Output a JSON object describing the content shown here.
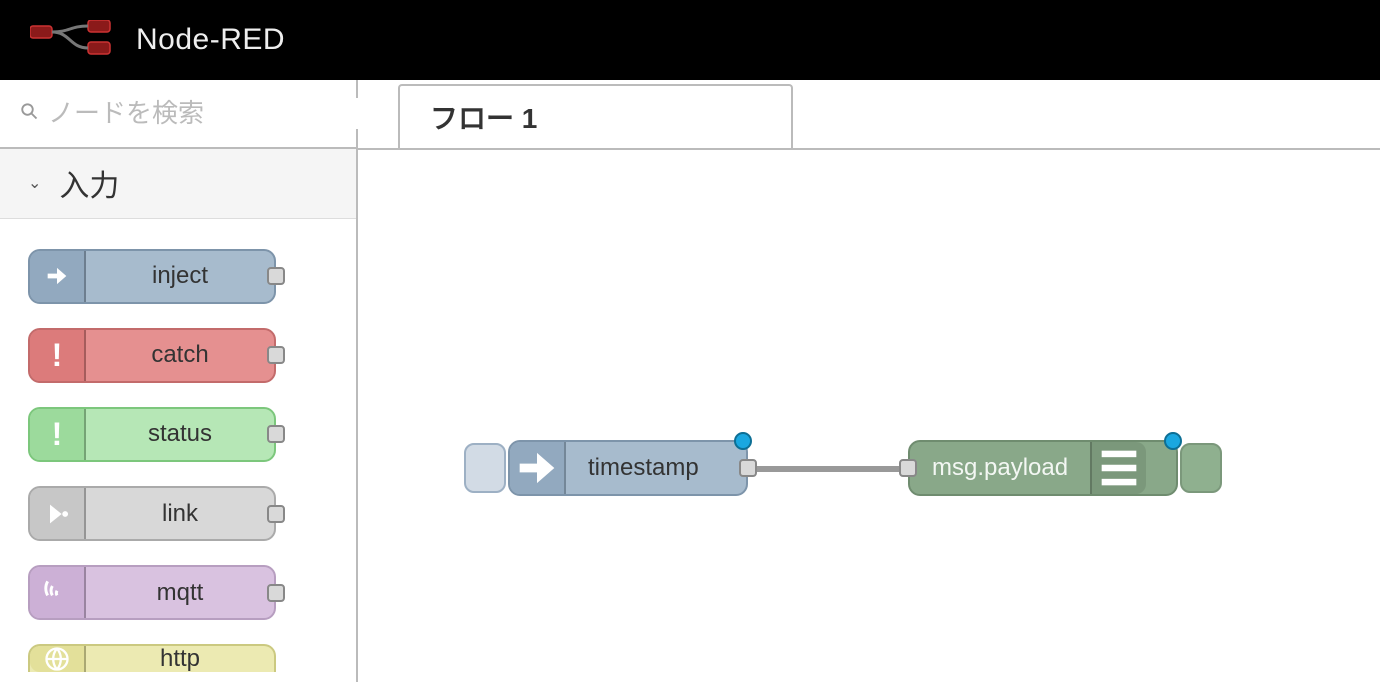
{
  "app": {
    "title": "Node-RED"
  },
  "search": {
    "placeholder": "ノードを検索"
  },
  "palette": {
    "category_label": "入力",
    "nodes": [
      {
        "kind": "inject",
        "label": "inject"
      },
      {
        "kind": "catch",
        "label": "catch"
      },
      {
        "kind": "status",
        "label": "status"
      },
      {
        "kind": "link",
        "label": "link"
      },
      {
        "kind": "mqtt",
        "label": "mqtt"
      },
      {
        "kind": "http",
        "label": "http"
      }
    ]
  },
  "workspace": {
    "tabs": [
      {
        "label": "フロー 1"
      }
    ]
  },
  "flow": {
    "nodes": [
      {
        "id": "inject1",
        "type": "inject",
        "label": "timestamp",
        "changed": true
      },
      {
        "id": "debug1",
        "type": "debug",
        "label": "msg.payload",
        "changed": true
      }
    ],
    "wires": [
      {
        "from": "inject1",
        "to": "debug1"
      }
    ]
  },
  "icons": {
    "inject": "arrow-right-icon",
    "catch": "exclamation-icon",
    "status": "exclamation-icon",
    "link": "link-out-icon",
    "mqtt": "wifi-icon",
    "http": "globe-icon",
    "debug": "bars-icon"
  }
}
